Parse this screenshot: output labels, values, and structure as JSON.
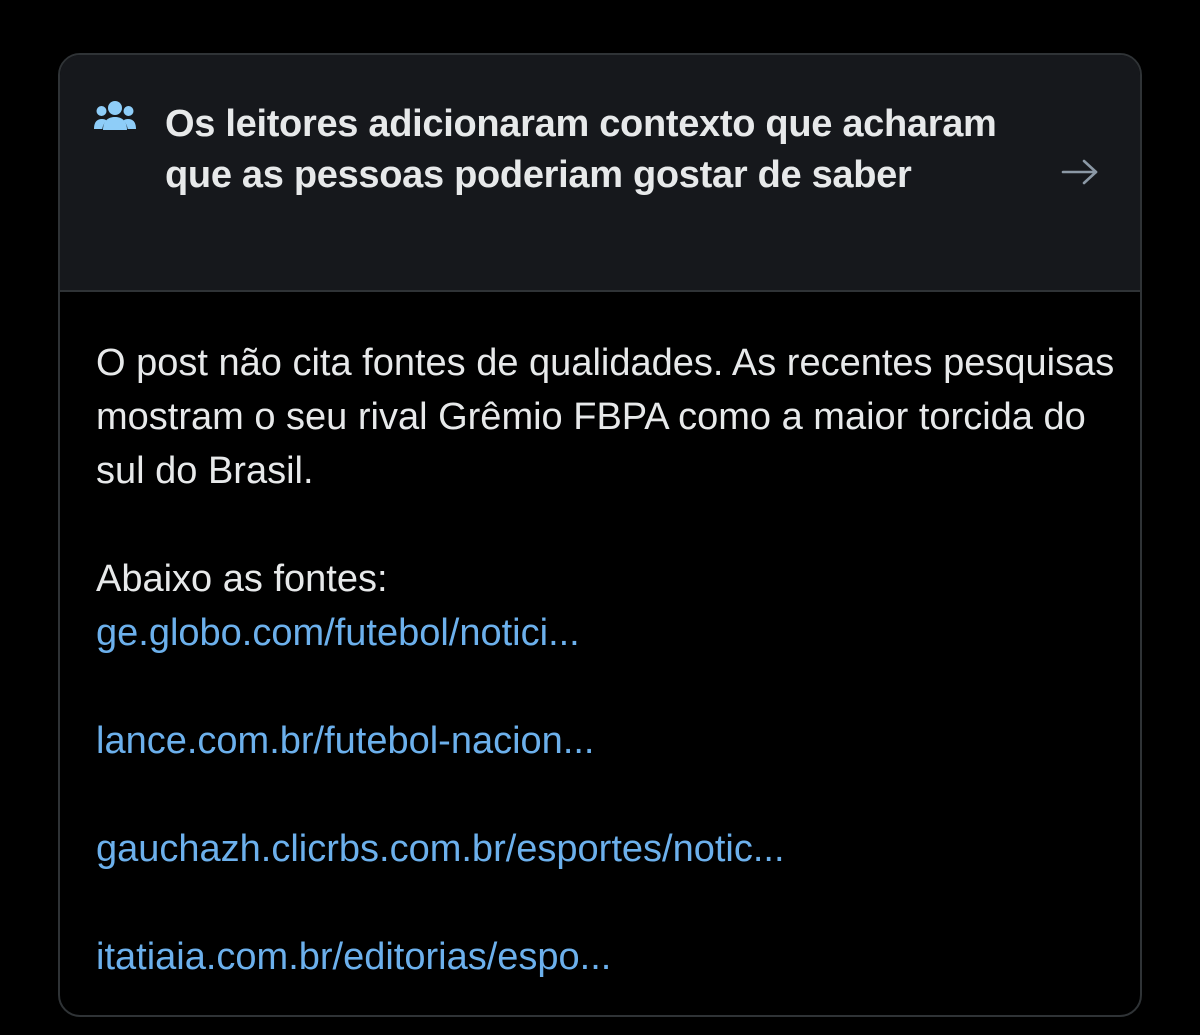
{
  "note": {
    "header": {
      "icon": "people-icon",
      "title": "Os leitores adicionaram contexto que acharam que as pessoas poderiam gostar de saber",
      "arrow_icon": "arrow-right-icon"
    },
    "body": {
      "paragraph": "O post não cita fontes de qualidades. As recentes pesquisas mostram o seu rival Grêmio FBPA como a maior torcida do sul do Brasil.",
      "sources_label": "Abaixo as fontes:",
      "links": [
        "ge.globo.com/futebol/notici...",
        "lance.com.br/futebol-nacion...",
        "gauchazh.clicrbs.com.br/esportes/notic...",
        "itatiaia.com.br/editorias/espo..."
      ]
    },
    "colors": {
      "background": "#000000",
      "header_background": "#16181c",
      "border": "#2f3336",
      "text": "#e7e9ea",
      "icon": "#8ecdf8",
      "link": "#6cb0ec"
    }
  }
}
